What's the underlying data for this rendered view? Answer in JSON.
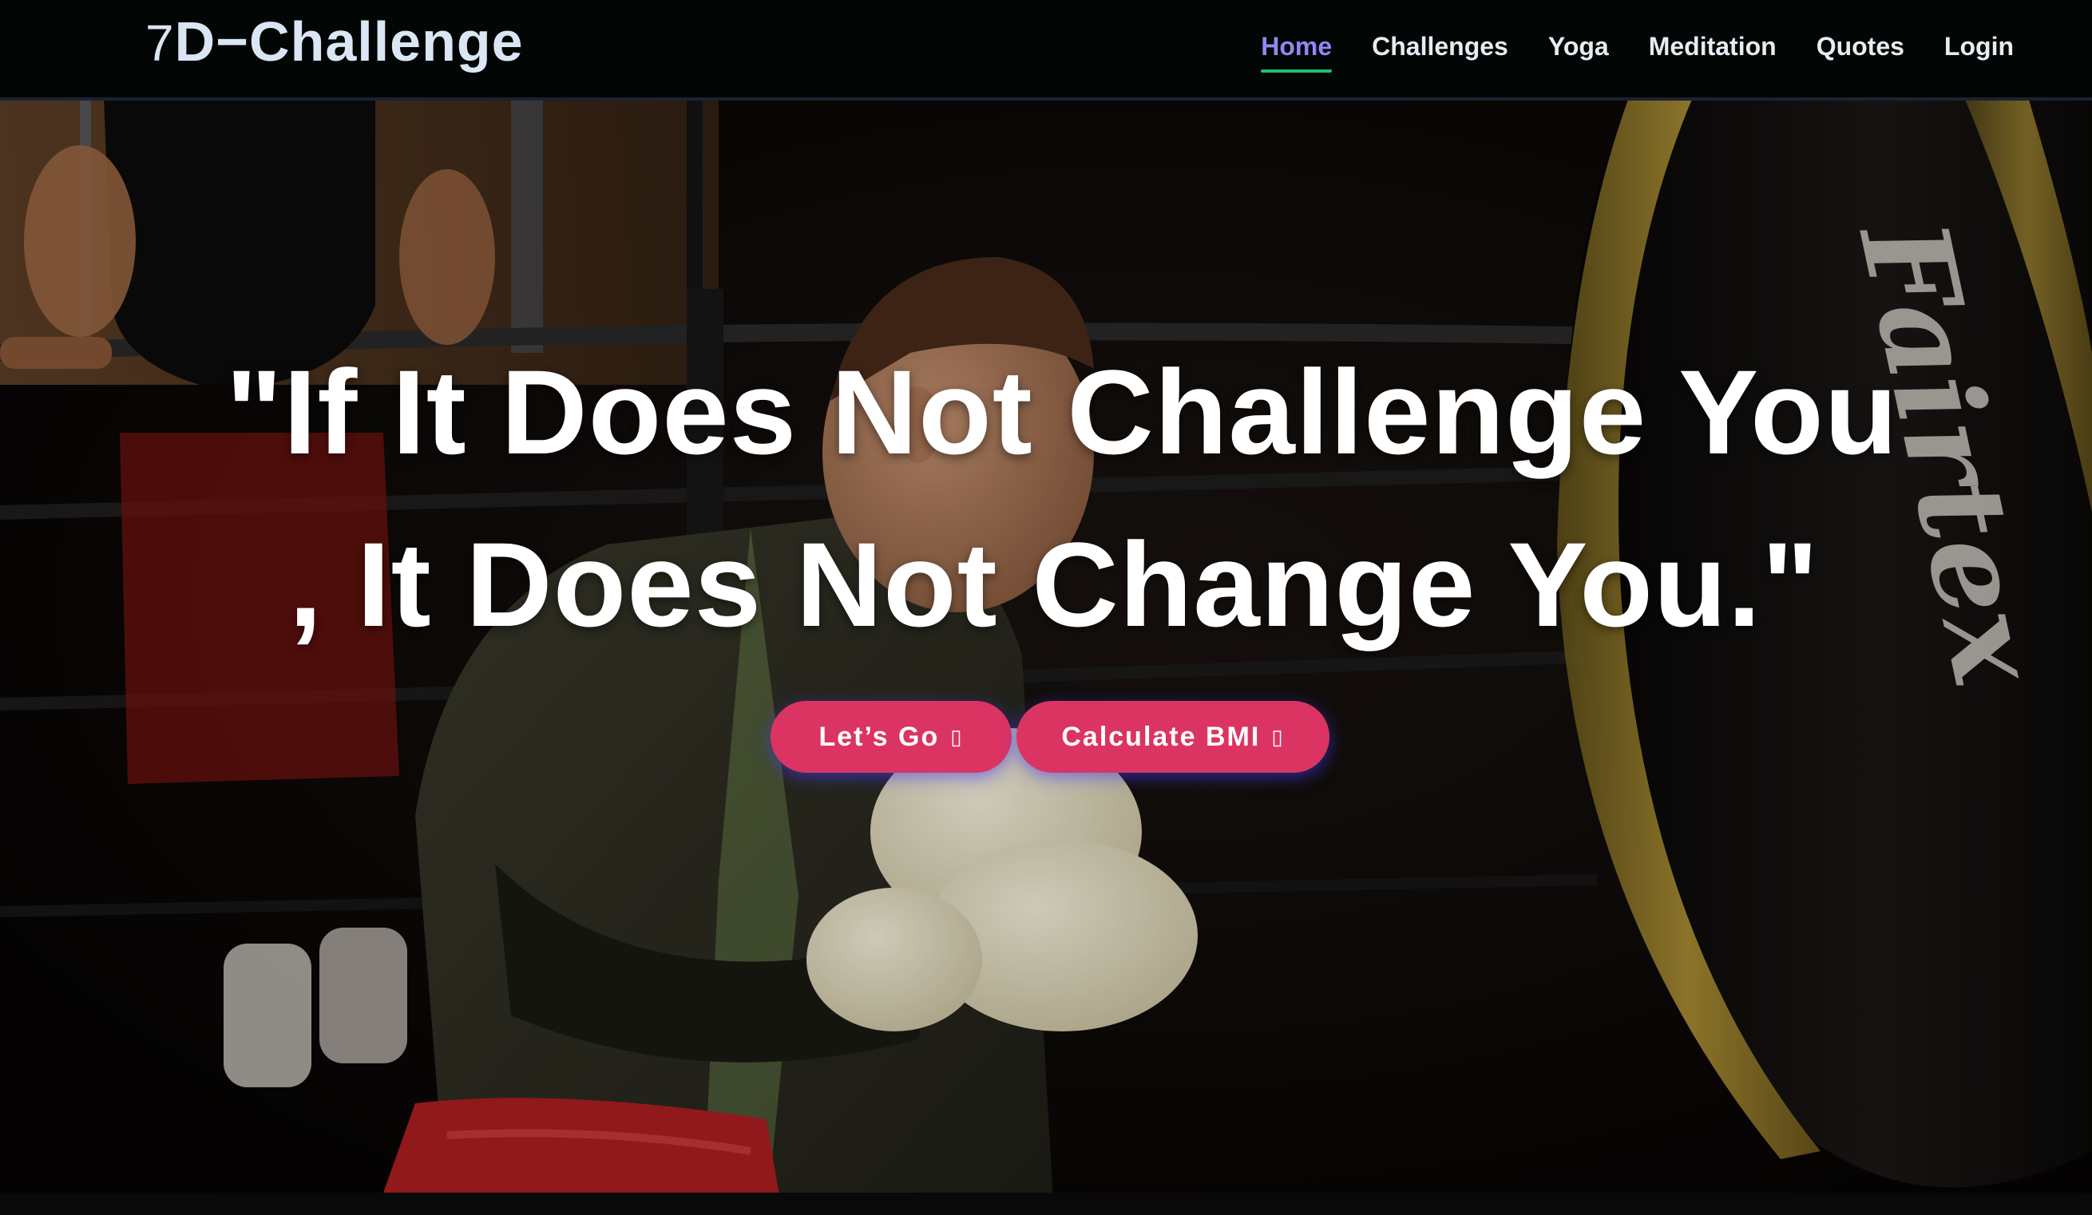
{
  "navbar": {
    "brand_prefix": "7",
    "brand_rest": "D−Challenge",
    "links": [
      {
        "label": "Home",
        "active": true
      },
      {
        "label": "Challenges",
        "active": false
      },
      {
        "label": "Yoga",
        "active": false
      },
      {
        "label": "Meditation",
        "active": false
      },
      {
        "label": "Quotes",
        "active": false
      },
      {
        "label": "Login",
        "active": false
      }
    ]
  },
  "hero": {
    "quote_line1": "\"If It Does Not Challenge You",
    "quote_line2": ", It Does Not Change You.\"",
    "buttons": {
      "lets_go": "Let’s Go",
      "calculate_bmi": "Calculate BMI"
    },
    "button_icon": "arrow-right-icon",
    "bag_brand_text": "Fairtex"
  },
  "colors": {
    "nav_background": "#020605",
    "brand_text": "#dbe6f5",
    "nav_active": "#8e88f4",
    "nav_active_underline": "#20c06a",
    "button_background": "#dc3462",
    "button_glow": "#463cff"
  }
}
